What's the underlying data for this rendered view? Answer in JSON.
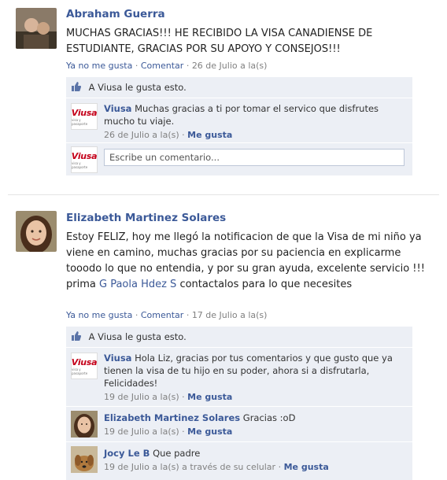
{
  "posts": [
    {
      "author": "Abraham Guerra",
      "text": "MUCHAS GRACIAS!!! HE RECIBIDO LA VISA CANADIENSE DE ESTUDIANTE, GRACIAS POR SU APOYO Y CONSEJOS!!!",
      "unlike": "Ya no me gusta",
      "dot": "·",
      "comment": "Comentar",
      "date": "26 de Julio a la(s)",
      "likes": "A Viusa le gusta esto.",
      "comments": [
        {
          "author": "Viusa",
          "text": "Muchas gracias a ti por tomar el servico que disfrutes mucho tu viaje.",
          "date": "26 de Julio a la(s)",
          "like": "Me gusta"
        }
      ],
      "input_placeholder": "Escribe un comentario..."
    },
    {
      "author": "Elizabeth Martinez Solares",
      "text_before": "Estoy FELIZ, hoy me llegó la notificacion de que la Visa de mi niño ya viene en camino, muchas gracias por su paciencia en explicarme tooodo lo que no entendia, y por su gran ayuda, excelente servicio !!! prima ",
      "mention": "G Paola Hdez S",
      "text_after": " contactalos para lo que necesites",
      "unlike": "Ya no me gusta",
      "dot": "·",
      "comment": "Comentar",
      "date": "17 de Julio a la(s)",
      "likes": "A Viusa le gusta esto.",
      "comments": [
        {
          "author": "Viusa",
          "text": "Hola Liz, gracias por tus comentarios y que gusto que ya tienen la visa de tu hijo en su poder, ahora si a disfrutarla, Felicidades!",
          "date": "19 de Julio a la(s)",
          "like": "Me gusta"
        },
        {
          "author": "Elizabeth Martinez Solares",
          "text": "Gracias :oD",
          "date": "19 de Julio a la(s)",
          "like": "Me gusta"
        },
        {
          "author": "Jocy Le B",
          "text": "Que padre",
          "date": "19 de Julio a la(s) a través de su celular",
          "like": "Me gusta"
        }
      ]
    }
  ],
  "brand": {
    "logo": "Viusa",
    "logo_sub": "visa y pasaporte"
  },
  "colors": {
    "link": "#3b5998",
    "panel": "#eceff5",
    "brand_red": "#c4001a"
  }
}
